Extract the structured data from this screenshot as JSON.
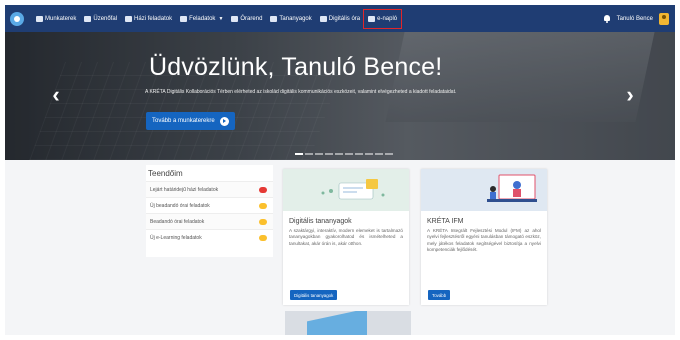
{
  "topnav": {
    "items": [
      {
        "label": "Munkaterek",
        "icon": "monitor-icon"
      },
      {
        "label": "Üzenőfal",
        "icon": "chat-icon"
      },
      {
        "label": "Házi feladatok",
        "icon": "document-icon"
      },
      {
        "label": "Feladatok",
        "icon": "clipboard-icon",
        "dropdown": true
      },
      {
        "label": "Órarend",
        "icon": "calendar-icon"
      },
      {
        "label": "Tananyagok",
        "icon": "book-icon"
      },
      {
        "label": "Digitális óra",
        "icon": "video-icon"
      },
      {
        "label": "e-napló",
        "icon": "car-icon",
        "highlighted": true
      }
    ],
    "user_name": "Tanuló Bence"
  },
  "hero": {
    "title": "Üdvözlünk, Tanuló Bence!",
    "subtitle": "A KRÉTA Digitális Kollaborációs Térben elérheted az iskolád digitális kommunikációs eszközeit, valamint elvégezheted a kiadott feladataidat.",
    "button_label": "Tovább a munkaterekre"
  },
  "todo": {
    "title": "Teendőim",
    "items": [
      {
        "label": "Lejárt határidejű házi feladatok",
        "badge_color": "#e53935"
      },
      {
        "label": "Új beadandó órai feladatok",
        "badge_color": "#fbc02d"
      },
      {
        "label": "Beadandó órai feladatok",
        "badge_color": "#fbc02d"
      },
      {
        "label": "Új e-Learning feladatok",
        "badge_color": "#fbc02d"
      }
    ]
  },
  "cards": {
    "digital": {
      "title": "Digitális tananyagok",
      "text": "A szaktárgyi, interaktív, modern elemeket is tartalmazó tananyagokban gyakorolhatod és ismételheted a tanultakat, akár órán is, akár otthon.",
      "button_label": "Digitális tananyagok"
    },
    "ifm": {
      "title": "KRÉTA IFM",
      "text": "A KRÉTA Integrált Fejlesztési Modul (IFM) az ahol nyelvi fejlesztésről egyéni tanulásban támogató eszköz, mely játékos feladatok segítségével biztosítja a nyelvi kompetenciák fejlődését.",
      "button_label": "Tovább"
    }
  },
  "colors": {
    "nav_bg": "#1f3d73",
    "primary": "#1565c0",
    "highlight_border": "#e0262a"
  }
}
